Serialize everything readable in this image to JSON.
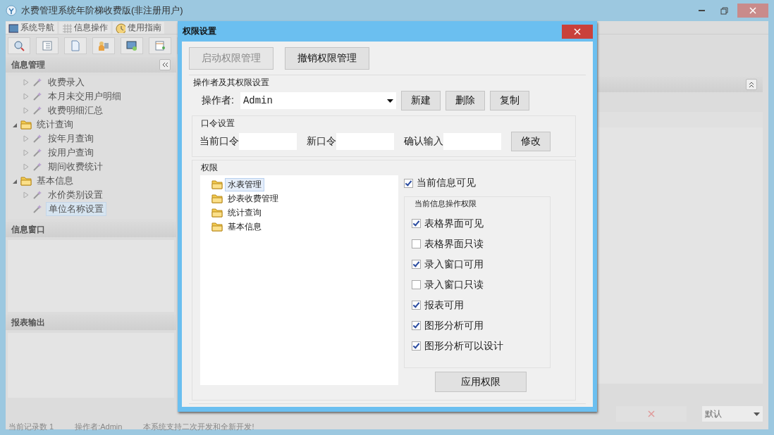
{
  "window": {
    "title": "水费管理系统年阶梯收费版(非注册用户)"
  },
  "tabs": [
    {
      "label": "系统导航",
      "selected": false
    },
    {
      "label": "信息操作",
      "selected": false
    },
    {
      "label": "使用指南",
      "selected": false
    }
  ],
  "sidebar": {
    "panels": [
      {
        "title": "信息管理",
        "kind": "tree",
        "items": [
          {
            "label": "收费录入",
            "kind": "item",
            "expanded": false,
            "selected": false
          },
          {
            "label": "本月未交用户明细",
            "kind": "item",
            "expanded": false,
            "selected": false
          },
          {
            "label": "收费明细汇总",
            "kind": "item",
            "expanded": false,
            "selected": false
          },
          {
            "label": "统计查询",
            "kind": "folder",
            "expanded": true,
            "selected": false,
            "children": [
              {
                "label": "按年月查询",
                "kind": "item",
                "expanded": false,
                "selected": false
              },
              {
                "label": "按用户查询",
                "kind": "item",
                "expanded": false,
                "selected": false
              },
              {
                "label": "期间收费统计",
                "kind": "item",
                "expanded": false,
                "selected": false
              }
            ]
          },
          {
            "label": "基本信息",
            "kind": "folder",
            "expanded": true,
            "selected": false,
            "children": [
              {
                "label": "水价类别设置",
                "kind": "item",
                "expanded": false,
                "selected": false
              },
              {
                "label": "单位名称设置",
                "kind": "item",
                "selected": true
              }
            ]
          }
        ]
      },
      {
        "title": "信息窗口",
        "kind": "empty"
      },
      {
        "title": "报表输出",
        "kind": "empty"
      }
    ]
  },
  "content": {
    "dropdown": {
      "value": "默认"
    }
  },
  "status_bar": [
    "当前记录数 1",
    "操作者:Admin",
    "本系统支持二次开发和全新开发!"
  ],
  "dialog": {
    "title": "权限设置",
    "top_buttons": [
      {
        "label": "启动权限管理",
        "disabled": true
      },
      {
        "label": "撤销权限管理",
        "disabled": false
      }
    ],
    "operator_section": {
      "title": "操作者及其权限设置",
      "label": "操作者:",
      "value": "Admin",
      "buttons": [
        "新建",
        "删除",
        "复制"
      ]
    },
    "password_group": {
      "title": "口令设置",
      "fields": [
        {
          "label": "当前口令"
        },
        {
          "label": "新口令"
        },
        {
          "label": "确认输入"
        }
      ],
      "button": "修改"
    },
    "permissions_group": {
      "title": "权限",
      "tree": [
        {
          "label": "水表管理",
          "selected": true
        },
        {
          "label": "抄表收费管理",
          "selected": false
        },
        {
          "label": "统计查询",
          "selected": false
        },
        {
          "label": "基本信息",
          "selected": false
        }
      ],
      "visible": {
        "label": "当前信息可见",
        "checked": true
      },
      "ops_group": {
        "title": "当前信息操作权限",
        "options": [
          {
            "label": "表格界面可见",
            "checked": true
          },
          {
            "label": "表格界面只读",
            "checked": false
          },
          {
            "label": "录入窗口可用",
            "checked": true
          },
          {
            "label": "录入窗口只读",
            "checked": false
          },
          {
            "label": "报表可用",
            "checked": true
          },
          {
            "label": "图形分析可用",
            "checked": true
          },
          {
            "label": "图形分析可以设计",
            "checked": true
          }
        ]
      },
      "apply_button": "应用权限"
    }
  }
}
